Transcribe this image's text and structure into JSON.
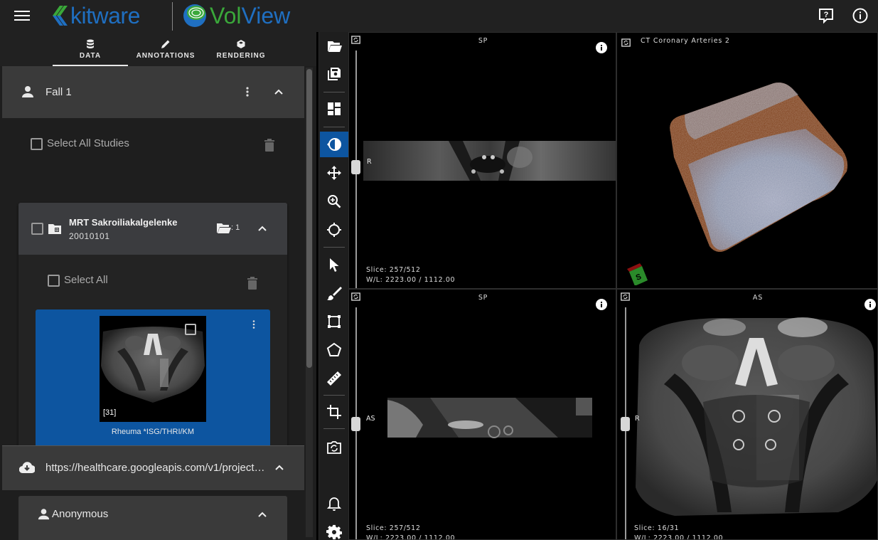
{
  "header": {
    "menu_icon": "hamburger-menu-icon",
    "brand_company": "kitware",
    "brand_product_part1": "Vol",
    "brand_product_part2": "View",
    "help_icon": "help-chat-icon",
    "about_icon": "info-circle-icon"
  },
  "tabs": [
    {
      "label": "DATA",
      "icon": "database-icon",
      "active": true
    },
    {
      "label": "ANNOTATIONS",
      "icon": "pencil-icon",
      "active": false
    },
    {
      "label": "RENDERING",
      "icon": "cube-icon",
      "active": false
    }
  ],
  "patient": {
    "name": "Fall 1",
    "select_all_studies": "Select All Studies",
    "study": {
      "title": "MRT Sakroiliakalgelenke",
      "date": "20010101",
      "series_count": ": 1",
      "select_all": "Select All",
      "series": [
        {
          "description": "Rheuma *ISG/THRI/KM",
          "slices": "[31]",
          "selected": true
        }
      ]
    }
  },
  "remote_source": {
    "url": "https://healthcare.googleapis.com/v1/project…",
    "patient": "Anonymous"
  },
  "toolbar": [
    {
      "name": "open-files",
      "icon": "folder-open-icon"
    },
    {
      "name": "save",
      "icon": "save-icon"
    },
    {
      "name": "layout",
      "icon": "layout-icon"
    },
    {
      "name": "window-level",
      "icon": "contrast-icon",
      "active": true
    },
    {
      "name": "pan",
      "icon": "move-icon"
    },
    {
      "name": "zoom",
      "icon": "zoom-in-icon"
    },
    {
      "name": "crosshairs",
      "icon": "crosshairs-icon"
    },
    {
      "name": "select",
      "icon": "cursor-icon"
    },
    {
      "name": "paint",
      "icon": "brush-icon"
    },
    {
      "name": "rectangle",
      "icon": "rectangle-icon"
    },
    {
      "name": "polygon",
      "icon": "polygon-icon"
    },
    {
      "name": "ruler",
      "icon": "ruler-icon"
    },
    {
      "name": "crop",
      "icon": "crop-icon"
    },
    {
      "name": "reset-views",
      "icon": "camera-reset-icon"
    },
    {
      "name": "notifications",
      "icon": "bell-icon"
    },
    {
      "name": "settings",
      "icon": "gear-icon"
    }
  ],
  "views": {
    "top_left": {
      "title": "SP",
      "orientation_left": "R",
      "slice": "Slice: 257/512",
      "wl": "W/L: 2223.00 / 1112.00"
    },
    "top_right": {
      "title": "CT Coronary Arteries 2",
      "orientation_cube_label": "S"
    },
    "bottom_left": {
      "title": "SP",
      "orientation_left": "AS",
      "slice": "Slice: 257/512",
      "wl": "W/L: 2223.00 / 1112.00"
    },
    "bottom_right": {
      "title": "AS",
      "orientation_left": "R",
      "slice": "Slice: 16/31",
      "wl": "W/L: 2223.00 / 1112.00"
    }
  },
  "colors": {
    "accent": "#0d55a0",
    "kitware_blue": "#1f6fc1",
    "volview_green": "#3aa83a"
  }
}
